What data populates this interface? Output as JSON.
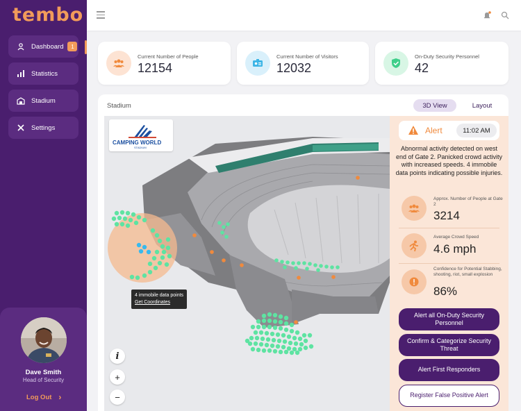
{
  "app": {
    "logo_text": "tembo"
  },
  "sidebar": {
    "items": [
      {
        "label": "Dashboard",
        "badge": "1"
      },
      {
        "label": "Statistics"
      },
      {
        "label": "Stadium"
      },
      {
        "label": "Settings"
      }
    ],
    "profile": {
      "name": "Dave Smith",
      "role": "Head of Security",
      "logout_label": "Log Out"
    }
  },
  "stats": [
    {
      "label": "Current Number of People",
      "value": "12154",
      "icon": "people-icon",
      "color": "#fde3d3"
    },
    {
      "label": "Current Number of Visitors",
      "value": "12032",
      "icon": "id-card-icon",
      "color": "#d9f0fb"
    },
    {
      "label": "On-Duty Security Personnel",
      "value": "42",
      "icon": "shield-icon",
      "color": "#d8f6e5"
    }
  ],
  "panel": {
    "title": "Stadium",
    "tabs": [
      {
        "label": "3D View",
        "active": true
      },
      {
        "label": "Layout",
        "active": false
      }
    ]
  },
  "map": {
    "venue_logo": {
      "name": "CAMPING WORLD",
      "sub": "STADIUM"
    },
    "tooltip": {
      "text": "4 immobile data points",
      "link": "Get Coordinates"
    },
    "controls": [
      "i",
      "+",
      "−"
    ]
  },
  "alert": {
    "title": "Alert",
    "time": "11:02 AM",
    "message": "Abnormal activity detected on west end of Gate 2. Panicked crowd activity with increased speeds. 4 immobile data points indicating possible injuries.",
    "metrics": [
      {
        "label": "Approx. Number of People at Gate 2",
        "value": "3214",
        "icon": "people-icon"
      },
      {
        "label": "Average Crowd Speed",
        "value": "4.6 mph",
        "icon": "running-icon"
      },
      {
        "label": "Confidence for Potential Stabbing, shooting, riot, small explosion",
        "value": "86%",
        "icon": "warning-icon"
      }
    ],
    "actions": [
      "Alert all On-Duty Security Personnel",
      "Confirm & Categorize Security Threat",
      "Alert First Responders",
      "Register False Positive Alert"
    ]
  },
  "colors": {
    "primary": "#4a1e6e",
    "accent": "#f29b5a",
    "alert_bg": "#fbe6d8",
    "crowd_dot": "#5ee3a2"
  }
}
